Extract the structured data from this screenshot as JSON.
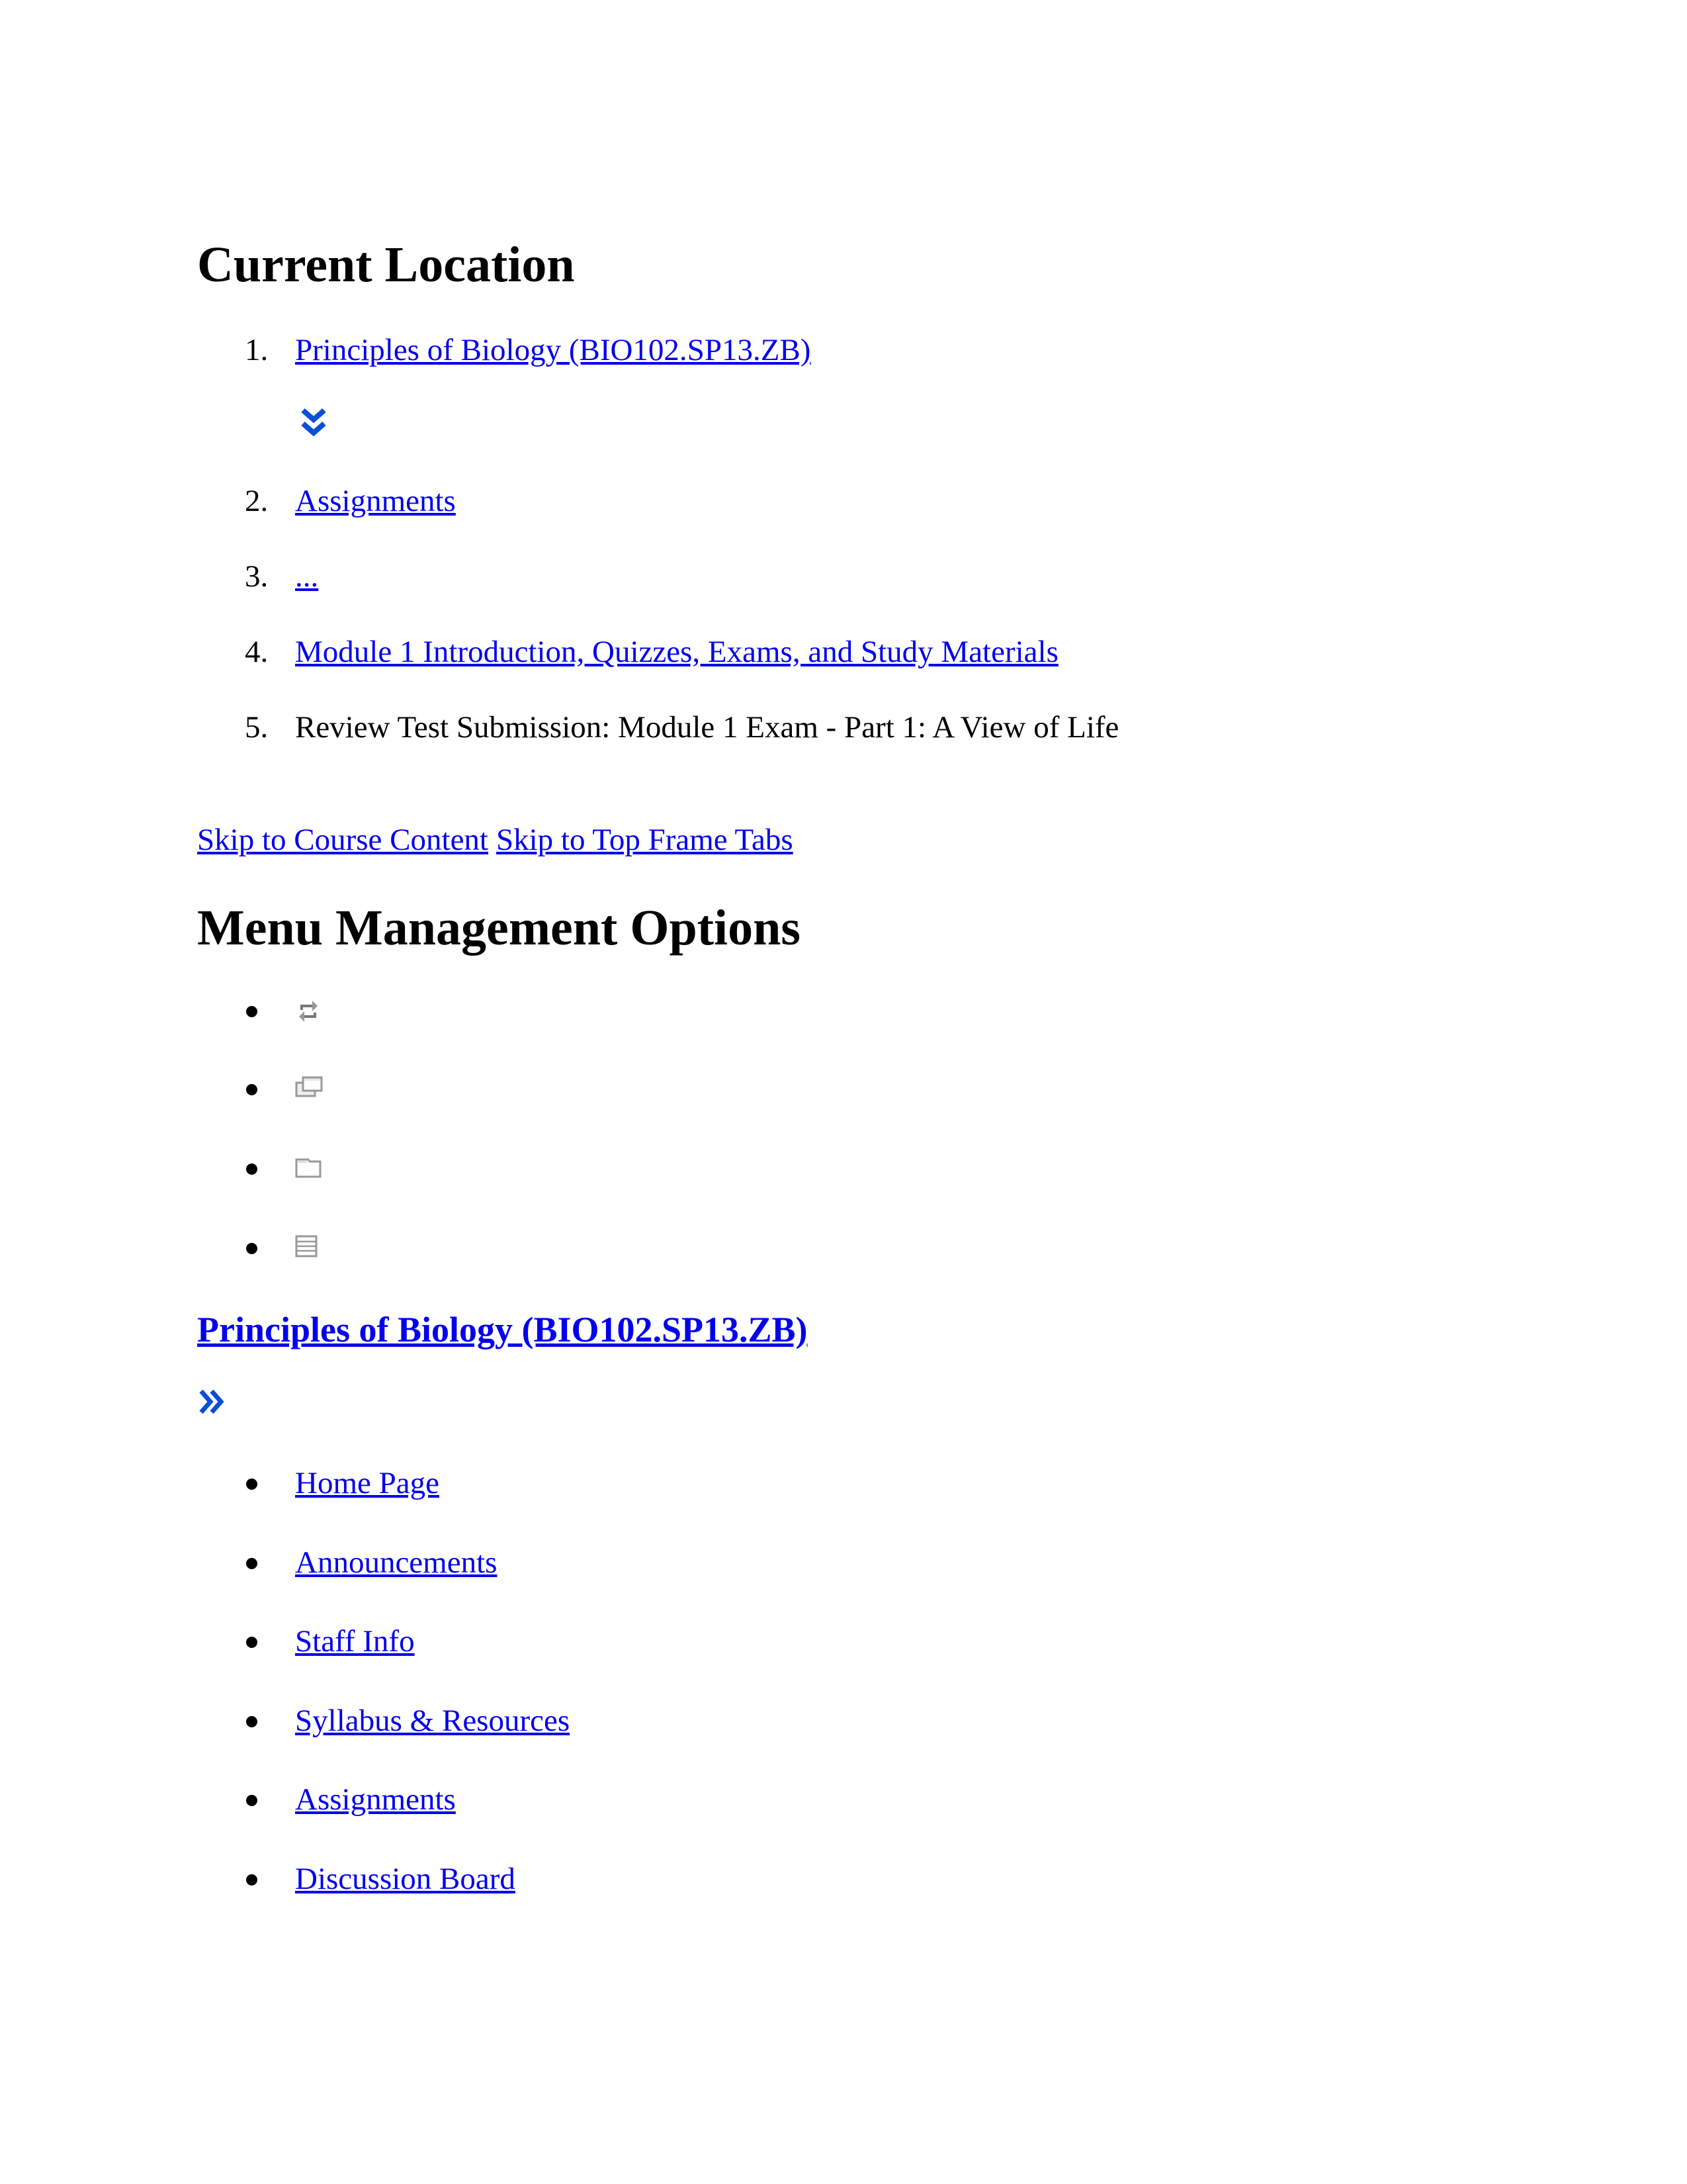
{
  "breadcrumb": {
    "heading": "Current Location",
    "items": [
      {
        "number": "1.",
        "label": "Principles of Biology (BIO102.SP13.ZB)",
        "is_link": true
      },
      {
        "number": "2.",
        "label": "Assignments",
        "is_link": true
      },
      {
        "number": "3.",
        "label": "...",
        "is_link": true
      },
      {
        "number": "4.",
        "label": "Module 1 Introduction, Quizzes, Exams, and Study Materials",
        "is_link": true
      },
      {
        "number": "5.",
        "label": "Review Test Submission: Module 1 Exam - Part 1: A View of Life",
        "is_link": false
      }
    ],
    "expand_icon": "double-chevron-down-icon"
  },
  "skip_links": {
    "course_content": "Skip to Course Content",
    "top_frame_tabs": "Skip to Top Frame Tabs"
  },
  "menu_management": {
    "heading": "Menu Management Options",
    "icons": [
      "refresh-icon",
      "detach-window-icon",
      "folder-view-icon",
      "list-view-icon"
    ]
  },
  "course_menu": {
    "title": "Principles of Biology (BIO102.SP13.ZB)",
    "expand_icon": "double-chevron-right-icon",
    "items": [
      {
        "label": "Home Page"
      },
      {
        "label": "Announcements"
      },
      {
        "label": "Staff Info"
      },
      {
        "label": "Syllabus & Resources"
      },
      {
        "label": "Assignments"
      },
      {
        "label": "Discussion Board"
      }
    ]
  },
  "colors": {
    "link": "#0000ee",
    "icon_blue": "#0a4fd6",
    "icon_gray": "#999999",
    "text": "#000000",
    "background": "#ffffff"
  }
}
